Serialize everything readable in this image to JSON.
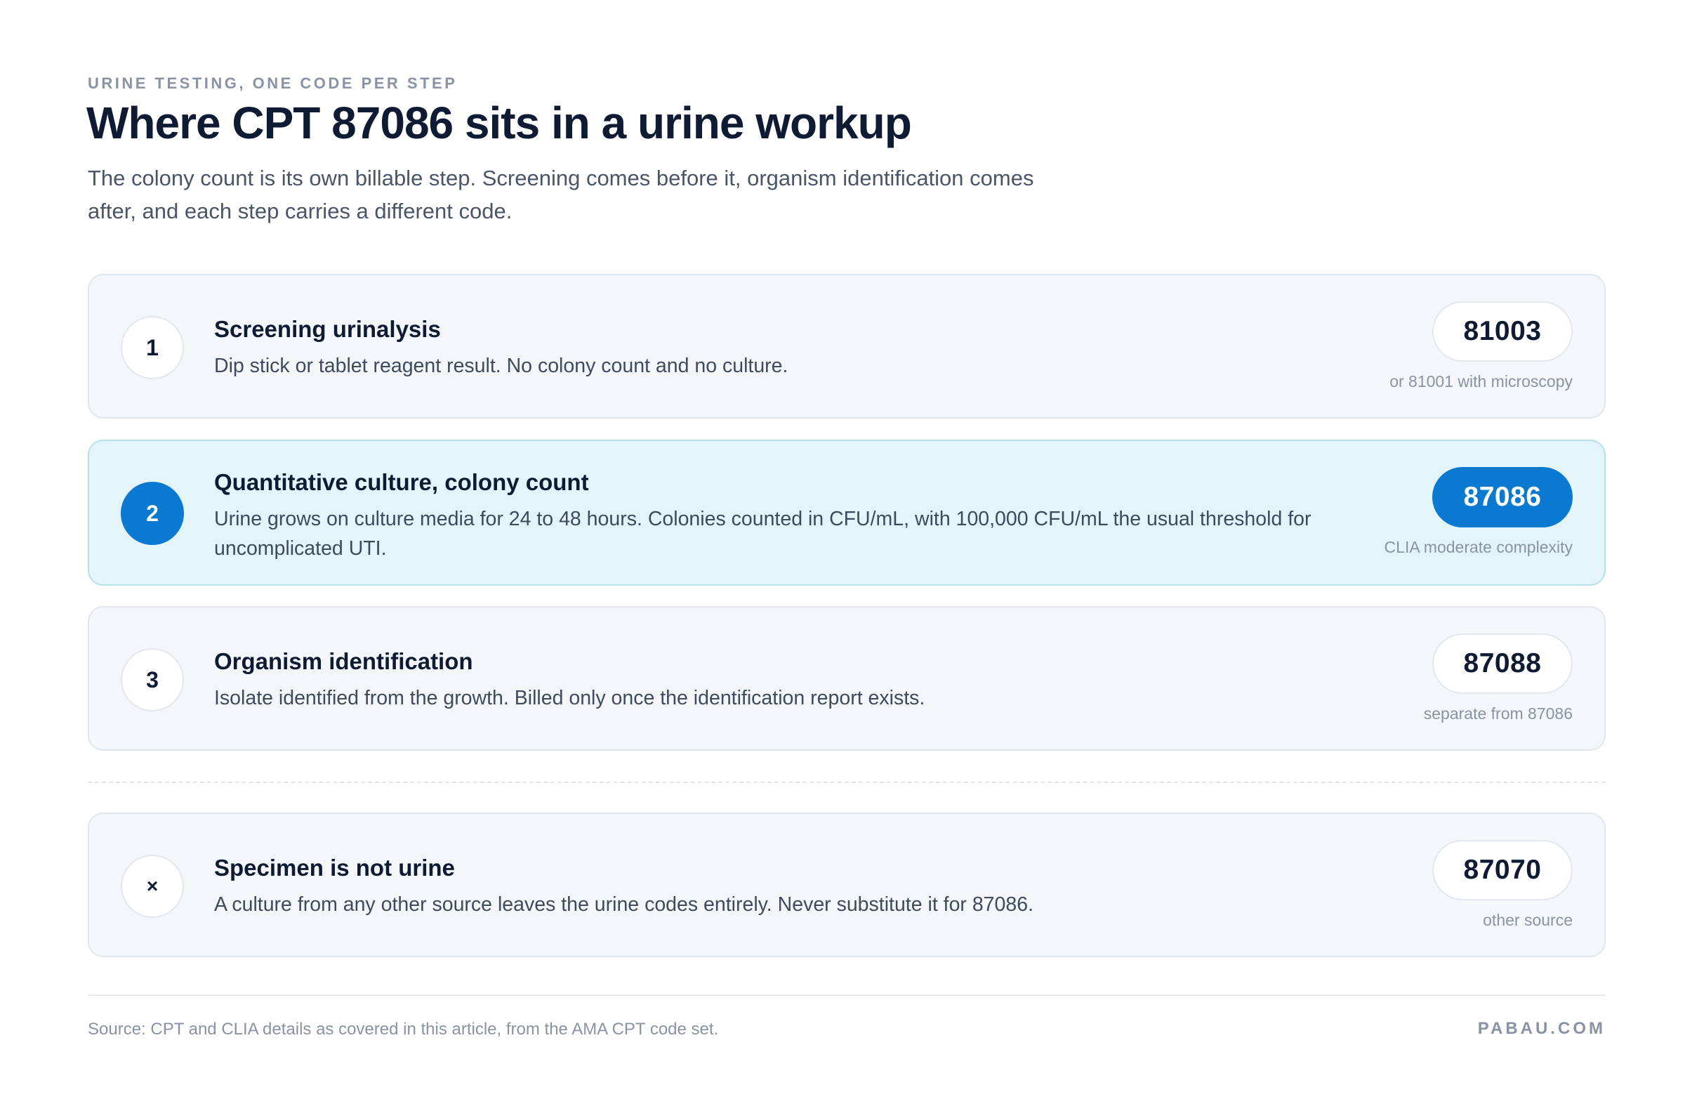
{
  "header": {
    "eyebrow": "URINE TESTING, ONE CODE PER STEP",
    "title": "Where CPT 87086 sits in a urine workup",
    "subtitle": "The colony count is its own billable step. Screening comes before it, organism identification comes after, and each step carries a different code."
  },
  "steps": [
    {
      "marker": "1",
      "title": "Screening urinalysis",
      "description": "Dip stick or tablet reagent result. No colony count and no culture.",
      "code": "81003",
      "note": "or 81001 with microscopy"
    },
    {
      "marker": "2",
      "title": "Quantitative culture, colony count",
      "description": "Urine grows on culture media for 24 to 48 hours. Colonies counted in CFU/mL, with 100,000 CFU/mL the usual threshold for uncomplicated UTI.",
      "code": "87086",
      "note": "CLIA moderate complexity",
      "highlighted": true
    },
    {
      "marker": "3",
      "title": "Organism identification",
      "description": "Isolate identified from the growth. Billed only once the identification report exists.",
      "code": "87088",
      "note": "separate from 87086"
    },
    {
      "marker": "×",
      "title": "Specimen is not urine",
      "description": "A culture from any other source leaves the urine codes entirely. Never substitute it for 87086.",
      "code": "87070",
      "note": "other source"
    }
  ],
  "footer": {
    "source": "Source: CPT and CLIA details as covered in this article, from the AMA CPT code set.",
    "brand": "PABAU.COM"
  },
  "colors": {
    "accent": "#0b79d0",
    "highlight_bg": "#e3f5fa",
    "card_bg": "#f4f7fa",
    "title": "#0f1b33",
    "muted": "#8a93a3"
  }
}
